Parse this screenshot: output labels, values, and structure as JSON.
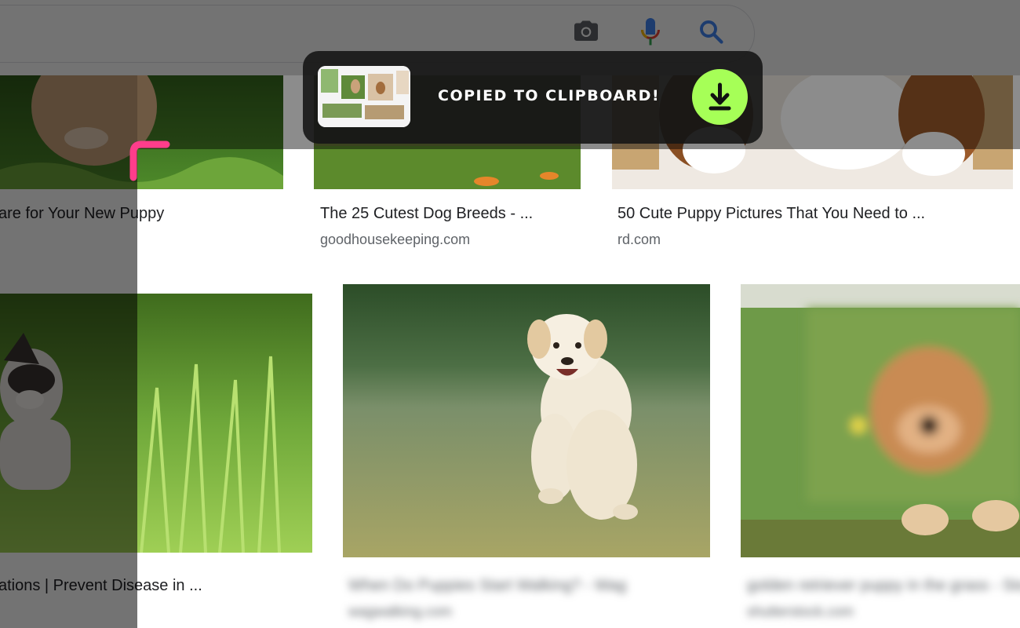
{
  "results": [
    {
      "title": "are for Your New Puppy",
      "site": ""
    },
    {
      "title": "The 25 Cutest Dog Breeds - ...",
      "site": "goodhousekeeping.com"
    },
    {
      "title": "50 Cute Puppy Pictures That You Need to ...",
      "site": "rd.com"
    },
    {
      "title": "ations | Prevent Disease in ...",
      "site": ""
    },
    {
      "title": "When Do Puppies Start Walking? - Wag",
      "site": "wagwalking.com"
    },
    {
      "title": "golden retriever puppy in the grass - Stock",
      "site": "shutterstock.com"
    }
  ],
  "toast": {
    "message": "COPIED TO CLIPBOARD!",
    "accent": "#a6ff57"
  },
  "icons": {
    "camera": "camera-icon",
    "mic": "microphone-icon",
    "search": "search-icon",
    "download": "download-icon",
    "corner": "selection-corner-handle"
  },
  "colors": {
    "selection_handle": "#ff3d8b",
    "overlay": "rgba(0,0,0,0.55)"
  }
}
